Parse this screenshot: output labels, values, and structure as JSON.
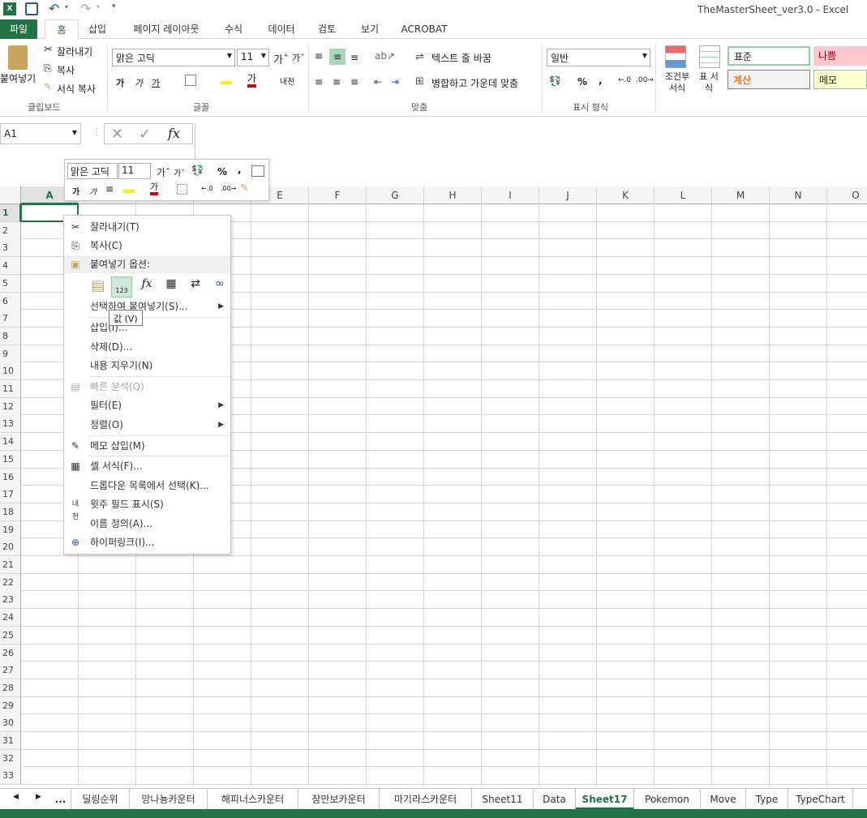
{
  "window": {
    "title": "TheMasterSheet_ver3.0 - Excel"
  },
  "tabs": [
    "파일",
    "홈",
    "삽입",
    "페이지 레이아웃",
    "수식",
    "데이터",
    "검토",
    "보기",
    "ACROBAT"
  ],
  "clipboard": {
    "paste": "붙여넣기",
    "cut": "잘라내기",
    "copy": "복사",
    "format_painter": "서식 복사",
    "label": "클립보드"
  },
  "font": {
    "name": "맑은 고딕",
    "size": "11",
    "label": "글꼴",
    "bold": "가",
    "italic": "가",
    "underline": "가",
    "color": "가"
  },
  "align": {
    "wrap": "텍스트 줄 바꿈",
    "merge": "병합하고 가운데 맞춤",
    "label": "맞춤"
  },
  "number": {
    "format": "일반",
    "label": "표시 형식",
    "percent": "%",
    "comma": ","
  },
  "styles": {
    "conditional": "조건부 서식",
    "table": "표 서식",
    "normal": "표준",
    "bad": "나쁨",
    "calc": "계산",
    "note": "메모"
  },
  "formula": {
    "namebox": "A1",
    "fx": "fx"
  },
  "mini": {
    "font": "맑은 고딕",
    "size": "11",
    "percent": "%",
    "comma": ","
  },
  "columns": [
    "A",
    "B",
    "C",
    "D",
    "E",
    "F",
    "G",
    "H",
    "I",
    "J",
    "K",
    "L",
    "M",
    "N",
    "O"
  ],
  "rows": [
    "1",
    "2",
    "3",
    "4",
    "5",
    "6",
    "7",
    "8",
    "9",
    "10",
    "11",
    "12",
    "13",
    "14",
    "15",
    "16",
    "17",
    "18",
    "19",
    "20",
    "21",
    "22",
    "23",
    "24",
    "25",
    "26",
    "27",
    "28",
    "29",
    "30",
    "31",
    "32",
    "33"
  ],
  "menu": {
    "cut": "잘라내기(T)",
    "copy": "복사(C)",
    "paste_options": "붙여넣기 옵션:",
    "paste_special": "선택하여 붙여넣기(S)...",
    "insert": "삽입(I)...",
    "delete": "삭제(D)...",
    "clear": "내용 지우기(N)",
    "quick": "빠른 분석(Q)",
    "filter": "필터(E)",
    "sort": "정렬(O)",
    "comment": "메모 삽입(M)",
    "format": "셀 서식(F)...",
    "dropdown": "드롭다운 목록에서 선택(K)...",
    "phonetic": "윗주 필드 표시(S)",
    "name": "이름 정의(A)...",
    "link": "하이퍼링크(I)...",
    "tooltip": "값 (V)"
  },
  "sheets": [
    "...",
    "딜링순위",
    "망나뇽카운터",
    "해피너스카운터",
    "잠만보카운터",
    "마기라스카운터",
    "Sheet11",
    "Data",
    "Sheet17",
    "Pokemon",
    "Move",
    "Type",
    "TypeChart"
  ],
  "active_sheet": "Sheet17",
  "colors": {
    "accent": "#217346",
    "grid": "#d4d4d4"
  }
}
